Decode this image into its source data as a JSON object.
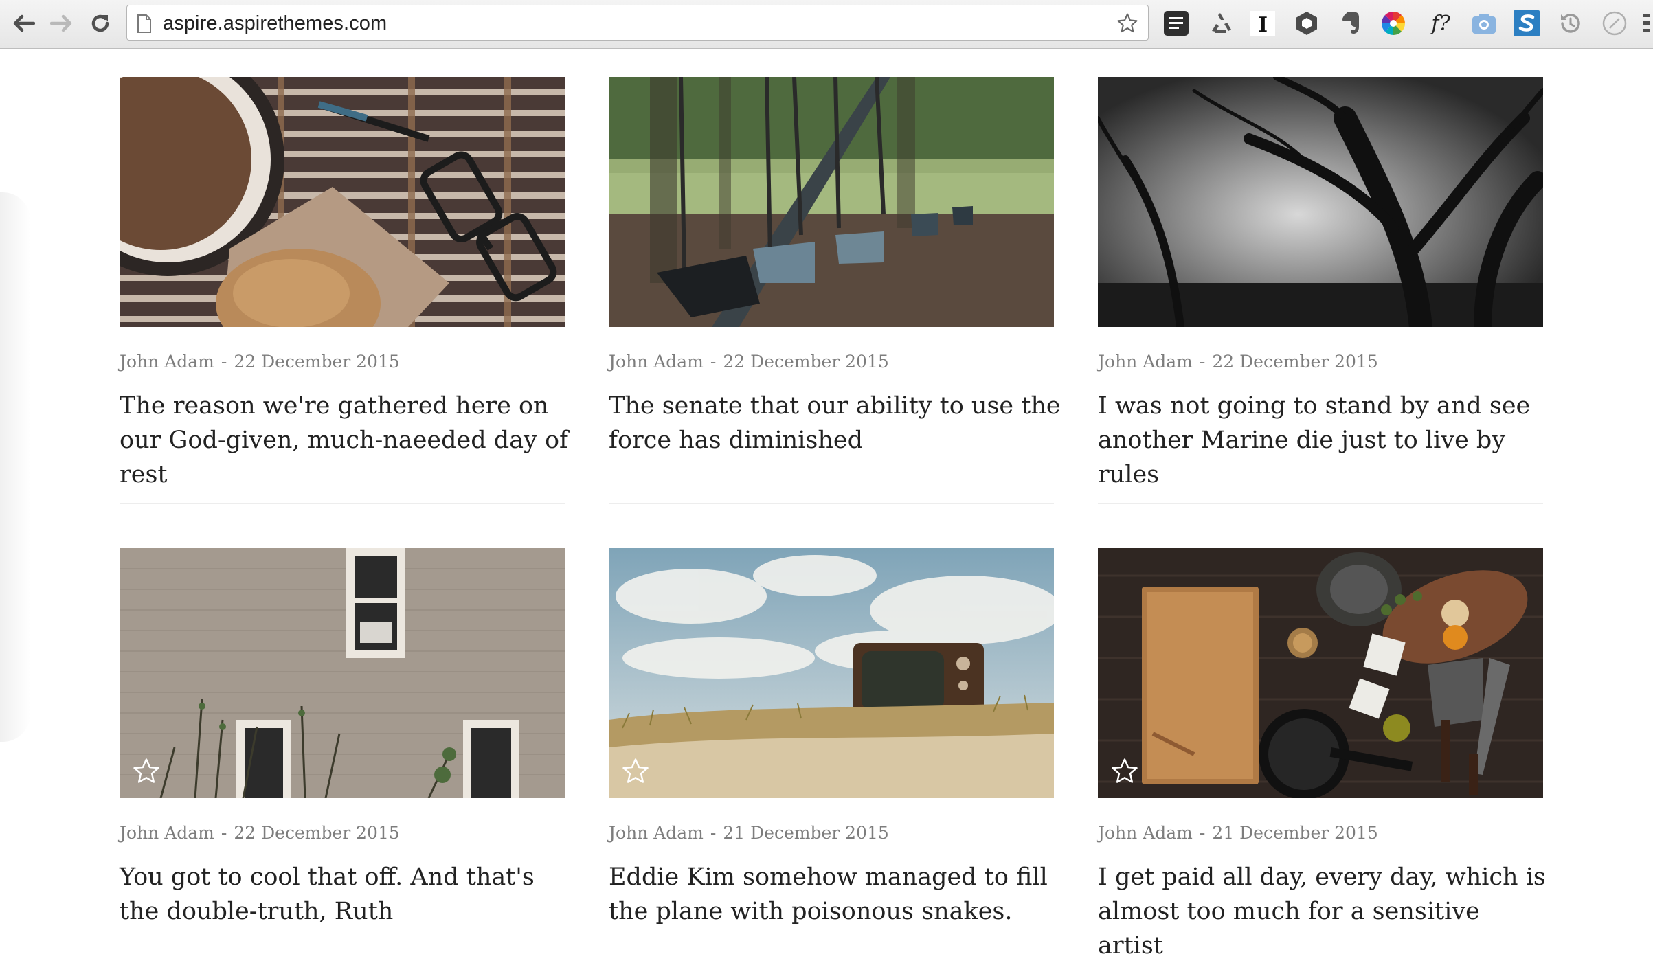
{
  "browser": {
    "url": "aspire.aspirethemes.com",
    "extensions": [
      "reader-icon",
      "recycle-icon",
      "instapaper-icon",
      "hexagon-icon",
      "evernote-icon",
      "color-wheel-icon",
      "font-finder-icon",
      "screenshot-icon",
      "s-icon",
      "history-icon",
      "compass-icon"
    ],
    "font_ext_label": "f?",
    "instapaper_label": "I"
  },
  "posts": [
    {
      "author": "John Adam",
      "separator": "-",
      "date": "22 December 2015",
      "title": "The reason we're gathered here on our God-given, much-naeeded day of rest",
      "featured": false,
      "image": "coffee-glasses-cookie"
    },
    {
      "author": "John Adam",
      "separator": "-",
      "date": "22 December 2015",
      "title": "The senate that our ability to use the force has diminished",
      "featured": false,
      "image": "playground-swings"
    },
    {
      "author": "John Adam",
      "separator": "-",
      "date": "22 December 2015",
      "title": "I was not going to stand by and see another Marine die just to live by rules",
      "featured": false,
      "image": "misty-trees-bw"
    },
    {
      "author": "John Adam",
      "separator": "-",
      "date": "22 December 2015",
      "title": "You got to cool that off. And that's the double-truth, Ruth",
      "featured": true,
      "image": "brick-wall-windows"
    },
    {
      "author": "John Adam",
      "separator": "-",
      "date": "21 December 2015",
      "title": "Eddie Kim somehow managed to fill the plane with poisonous snakes.",
      "featured": true,
      "image": "tv-on-sand"
    },
    {
      "author": "John Adam",
      "separator": "-",
      "date": "21 December 2015",
      "title": "I get paid all day, every day, which is almost too much for a sensitive artist",
      "featured": true,
      "image": "kitchen-table-top"
    }
  ],
  "colors": {
    "text": "#222222",
    "meta": "#7d7d7d",
    "divider": "#ededed"
  }
}
